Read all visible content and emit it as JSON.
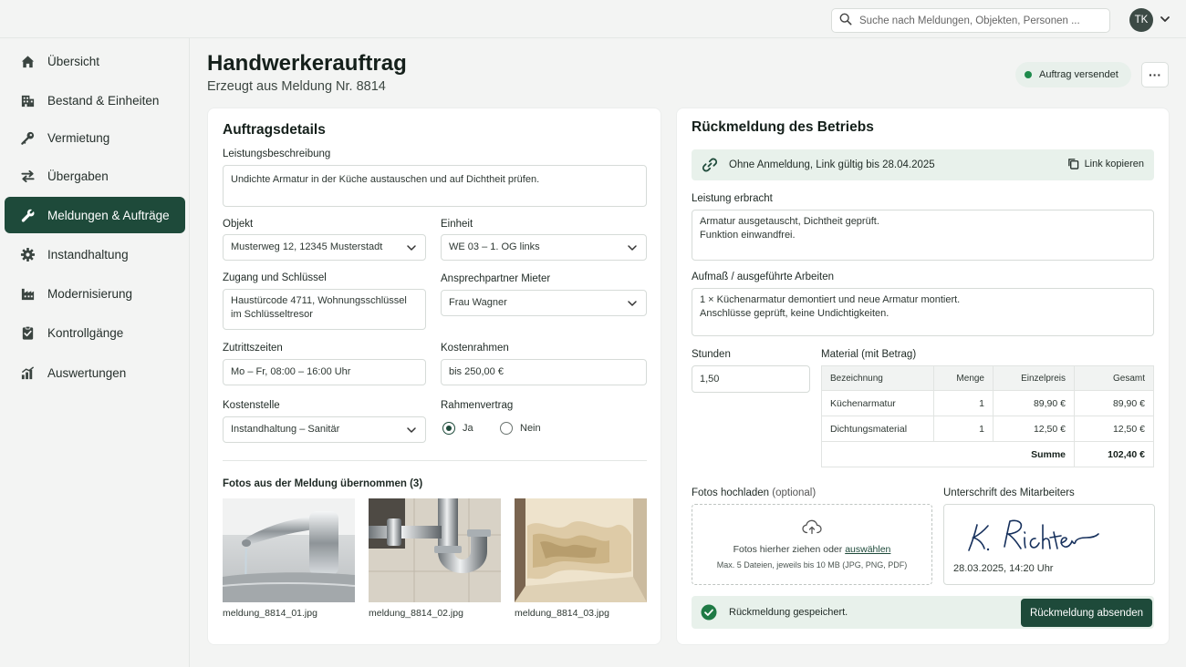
{
  "search": {
    "placeholder": "Suche nach Meldungen, Objekten, Personen ..."
  },
  "user": {
    "initials": "TK"
  },
  "sidebar": {
    "items": [
      {
        "label": "Übersicht",
        "icon": "home-icon"
      },
      {
        "label": "Bestand & Einheiten",
        "icon": "building-icon"
      },
      {
        "label": "Vermietung",
        "icon": "key-icon"
      },
      {
        "label": "Übergaben",
        "icon": "swap-icon"
      },
      {
        "label": "Meldungen & Aufträge",
        "icon": "wrench-icon",
        "active": true
      },
      {
        "label": "Instandhaltung",
        "icon": "gear-icon"
      },
      {
        "label": "Modernisierung",
        "icon": "factory-icon"
      },
      {
        "label": "Kontrollgänge",
        "icon": "checklist-icon"
      },
      {
        "label": "Auswertungen",
        "icon": "bar-chart-icon"
      }
    ]
  },
  "header": {
    "title": "Handwerkerauftrag",
    "subtitle": "Erzeugt aus Meldung Nr. 8814",
    "status": "Auftrag versendet",
    "more": "···"
  },
  "details": {
    "title": "Auftragsdetails",
    "leistung_label": "Leistungsbeschreibung",
    "leistung_value": "Undichte Armatur in der Küche austauschen und auf Dichtheit prüfen.",
    "objekt_label": "Objekt",
    "objekt_value": "Musterweg 12, 12345 Musterstadt",
    "einheit_label": "Einheit",
    "einheit_value": "WE 03 – 1. OG links",
    "zugang_label": "Zugang und Schlüssel",
    "zugang_value": "Haustürcode 4711, Wohnungsschlüssel im Schlüsseltresor",
    "ansprech_label": "Ansprechpartner Mieter",
    "ansprech_value": "Frau Wagner",
    "zutritt_label": "Zutrittszeiten",
    "zutritt_value": "Mo – Fr, 08:00 – 16:00 Uhr",
    "kosten_label": "Kostenrahmen",
    "kosten_value": "bis 250,00 €",
    "kostenstelle_label": "Kostenstelle",
    "kostenstelle_value": "Instandhaltung – Sanitär",
    "rahmen_label": "Rahmenvertrag",
    "rahmen_ja": "Ja",
    "rahmen_nein": "Nein",
    "photos_title": "Fotos aus der Meldung übernommen (3)",
    "photos": [
      "meldung_8814_01.jpg",
      "meldung_8814_02.jpg",
      "meldung_8814_03.jpg"
    ]
  },
  "feedback": {
    "title": "Rückmeldung des Betriebs",
    "link_text": "Ohne Anmeldung, Link gültig bis 28.04.2025",
    "copy_label": "Link kopieren",
    "leistung_label": "Leistung erbracht",
    "leistung_value": "Armatur ausgetauscht, Dichtheit geprüft.\nFunktion einwandfrei.",
    "aufmass_label": "Aufmaß / ausgeführte Arbeiten",
    "aufmass_value": "1 × Küchenarmatur demontiert und neue Armatur montiert.\nAnschlüsse geprüft, keine Undichtigkeiten.",
    "stunden_label": "Stunden",
    "stunden_value": "1,50",
    "material_label": "Material (mit Betrag)",
    "material_headers": [
      "Bezeichnung",
      "Menge",
      "Einzelpreis",
      "Gesamt"
    ],
    "material_rows": [
      [
        "Küchenarmatur",
        "1",
        "89,90 €",
        "89,90 €"
      ],
      [
        "Dichtungsmaterial",
        "1",
        "12,50 €",
        "12,50 €"
      ]
    ],
    "sum_label": "Summe",
    "sum_value": "102,40 €",
    "upload_label": "Fotos hochladen",
    "upload_optional": "(optional)",
    "upload_text": "Fotos hierher ziehen oder",
    "upload_link": "auswählen",
    "upload_hint": "Max. 5 Dateien, jeweils bis 10 MB (JPG, PNG, PDF)",
    "signature_label": "Unterschrift des Mitarbeiters",
    "signature_name": "K. Richter",
    "signature_date": "28.03.2025, 14:20 Uhr",
    "saved_text": "Rückmeldung gespeichert.",
    "send_label": "Rückmeldung absenden"
  },
  "colors": {
    "accent": "#1e4a3a",
    "status_green": "#1f8a4c",
    "success_bg": "#e8f1eb"
  }
}
